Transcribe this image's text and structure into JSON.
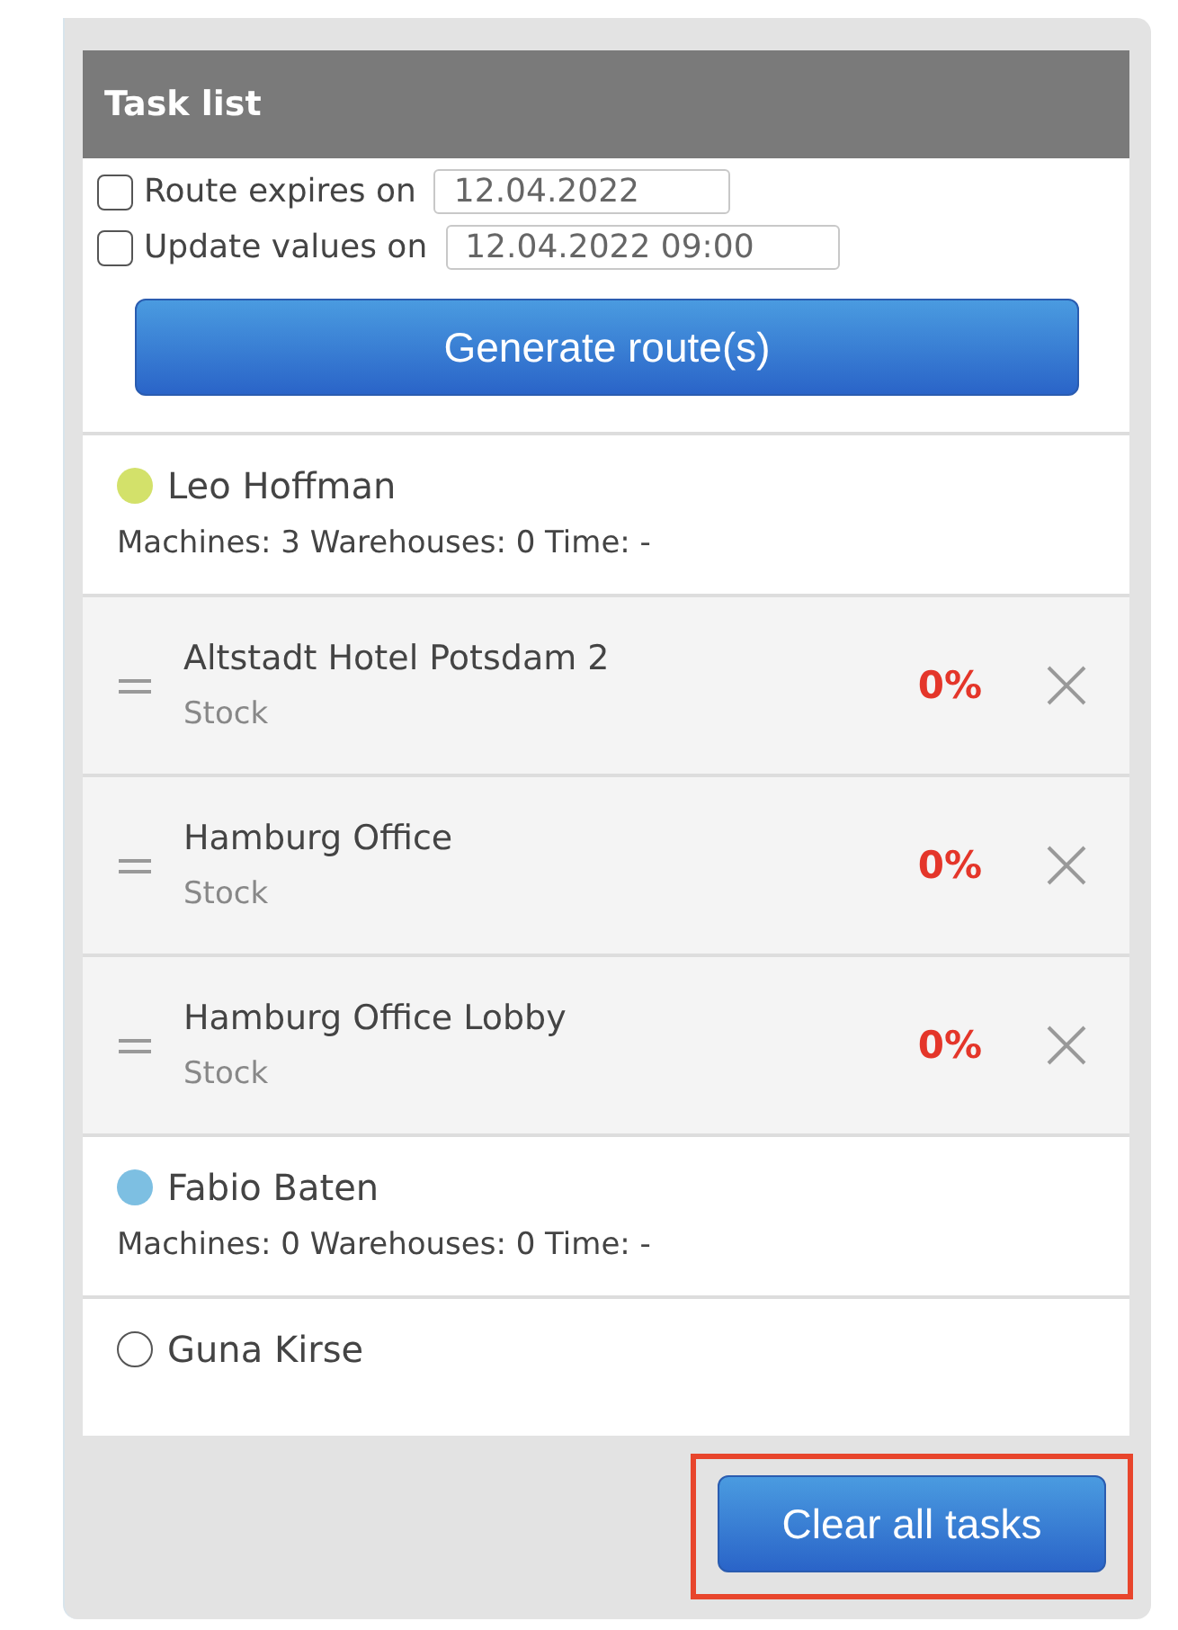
{
  "panel": {
    "title": "Task list"
  },
  "options": [
    {
      "label": "Route expires on",
      "checked": false,
      "value": "12.04.2022"
    },
    {
      "label": "Update values on",
      "checked": false,
      "value": "12.04.2022 09:00"
    }
  ],
  "generate_button": "Generate route(s)",
  "drivers": [
    {
      "name": "Leo Hoffman",
      "color": "#d3e16a",
      "summary": "Machines: 3 Warehouses: 0 Time: -",
      "tasks": [
        {
          "name": "Altstadt Hotel Potsdam 2",
          "type": "Stock",
          "percent": "0%"
        },
        {
          "name": "Hamburg Office",
          "type": "Stock",
          "percent": "0%"
        },
        {
          "name": "Hamburg Office Lobby",
          "type": "Stock",
          "percent": "0%"
        }
      ]
    },
    {
      "name": "Fabio Baten",
      "color": "#7dbfe2",
      "summary": "Machines: 0 Warehouses: 0 Time: -"
    },
    {
      "name": "Guna Kirse",
      "color": "#ffffff"
    }
  ],
  "clear_button": {
    "label": "Clear all tasks",
    "highlighted": true
  }
}
